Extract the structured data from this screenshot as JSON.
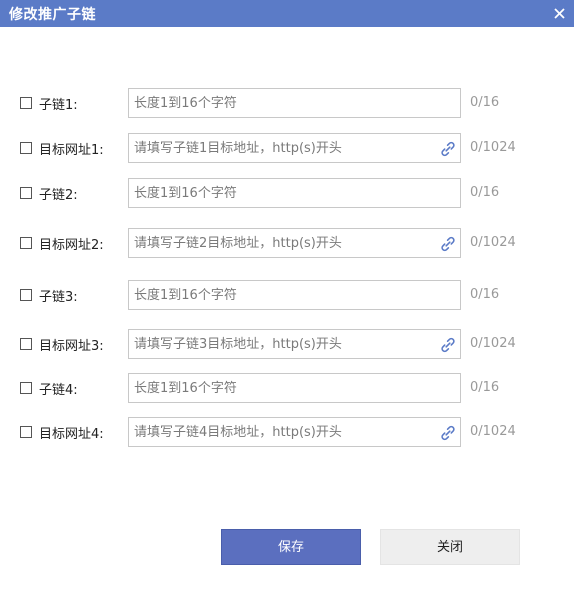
{
  "dialog": {
    "title": "修改推广子链"
  },
  "rows": [
    {
      "label": "子链1:",
      "placeholder": "长度1到16个字符",
      "counter": "0/16",
      "has_link_icon": false
    },
    {
      "label": "目标网址1:",
      "placeholder": "请填写子链1目标地址，http(s)开头",
      "counter": "0/1024",
      "has_link_icon": true
    },
    {
      "label": "子链2:",
      "placeholder": "长度1到16个字符",
      "counter": "0/16",
      "has_link_icon": false
    },
    {
      "label": "目标网址2:",
      "placeholder": "请填写子链2目标地址，http(s)开头",
      "counter": "0/1024",
      "has_link_icon": true
    },
    {
      "label": "子链3:",
      "placeholder": "长度1到16个字符",
      "counter": "0/16",
      "has_link_icon": false
    },
    {
      "label": "目标网址3:",
      "placeholder": "请填写子链3目标地址，http(s)开头",
      "counter": "0/1024",
      "has_link_icon": true
    },
    {
      "label": "子链4:",
      "placeholder": "长度1到16个字符",
      "counter": "0/16",
      "has_link_icon": false
    },
    {
      "label": "目标网址4:",
      "placeholder": "请填写子链4目标地址，http(s)开头",
      "counter": "0/1024",
      "has_link_icon": true
    }
  ],
  "buttons": {
    "save_label": "保存",
    "close_label": "关闭"
  },
  "colors": {
    "titlebar": "#5b7bc7",
    "save_button": "#5b6fbf",
    "close_button": "#eeeeee",
    "link_icon": "#5b7bc7"
  },
  "icons": {
    "close": "close-icon",
    "link": "link-icon"
  }
}
